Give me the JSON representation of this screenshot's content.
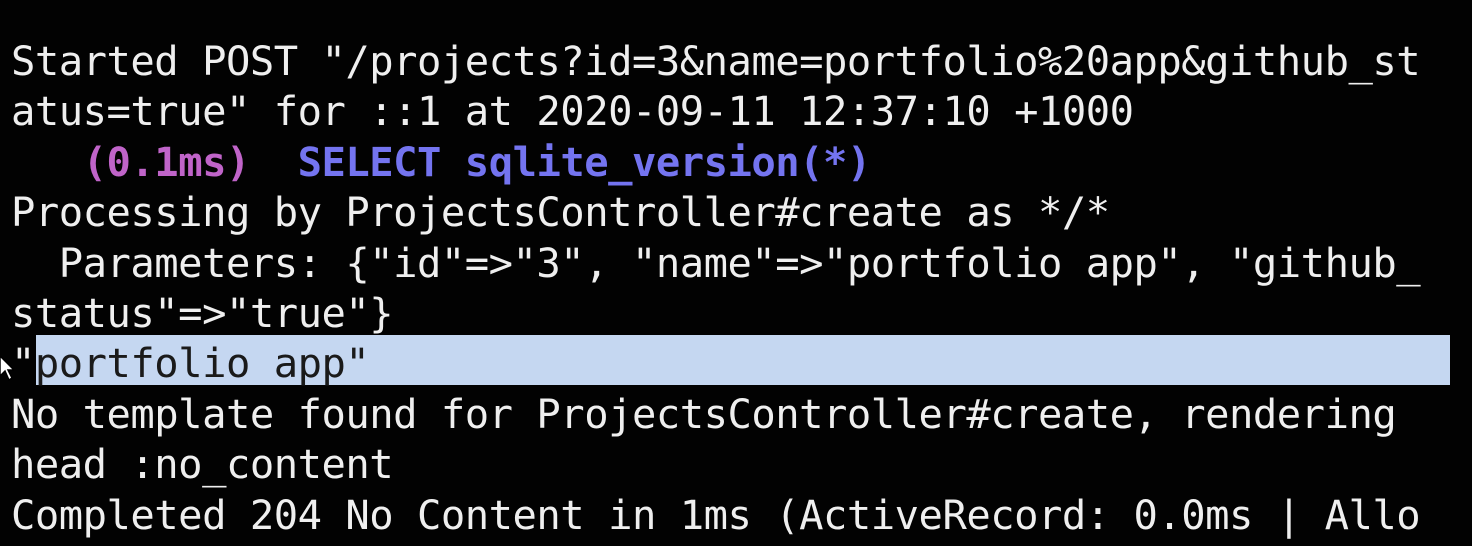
{
  "terminal": {
    "lines": {
      "l1": "Started POST \"/projects?id=3&name=portfolio%20app&github_st",
      "l2": "atus=true\" for ::1 at 2020-09-11 12:37:10 +1000",
      "l3_indent": "   ",
      "l3_timing": "(0.1ms)",
      "l3_gap": "  ",
      "l3_sql": "SELECT sqlite_version(*)",
      "l4": "Processing by ProjectsController#create as */*",
      "l5": "  Parameters: {\"id\"=>\"3\", \"name\"=>\"portfolio app\", \"github_",
      "l6": "status\"=>\"true\"}",
      "l7_prefix": "\"",
      "l7_selected": "portfolio app\"",
      "l8": "No template found for ProjectsController#create, rendering",
      "l9": "head :no_content",
      "l10": "Completed 204 No Content in 1ms (ActiveRecord: 0.0ms | Allo"
    },
    "colors": {
      "background": "#020202",
      "text": "#efefef",
      "timing": "#c064c9",
      "sql_keyword": "#7474f0",
      "selection": "#c5d7f1"
    },
    "icons": {
      "pointer": "mouse-pointer-icon"
    }
  }
}
